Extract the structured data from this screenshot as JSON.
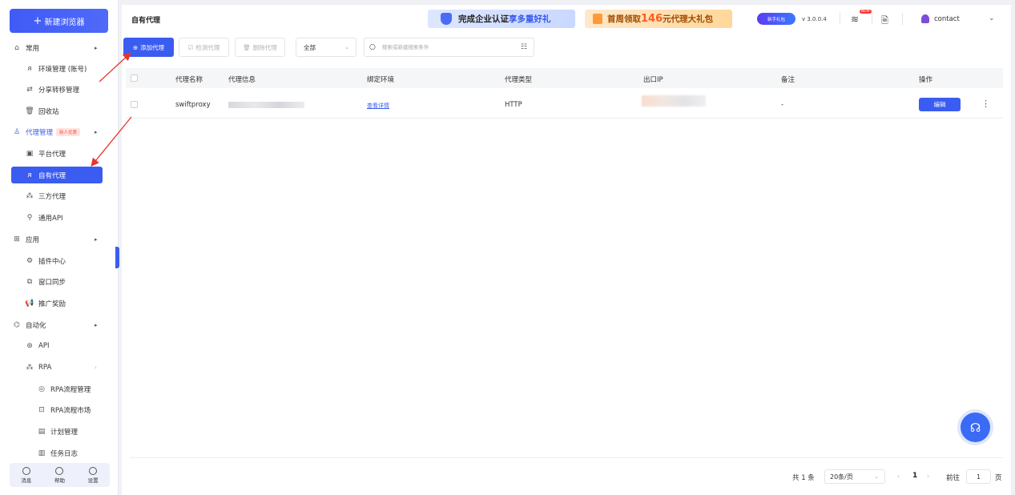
{
  "sidebar": {
    "new_browser": "新建浏览器",
    "items": [
      {
        "label": "常用",
        "level": "group"
      },
      {
        "label": "环境管理 (账号)",
        "level": "sub"
      },
      {
        "label": "分享转移管理",
        "level": "sub"
      },
      {
        "label": "回收站",
        "level": "sub"
      },
      {
        "label": "代理管理",
        "level": "group",
        "badge": "新人优惠"
      },
      {
        "label": "平台代理",
        "level": "sub"
      },
      {
        "label": "自有代理",
        "level": "sub",
        "active": true
      },
      {
        "label": "三方代理",
        "level": "sub"
      },
      {
        "label": "通用API",
        "level": "sub"
      },
      {
        "label": "应用",
        "level": "group"
      },
      {
        "label": "插件中心",
        "level": "sub"
      },
      {
        "label": "窗口同步",
        "level": "sub"
      },
      {
        "label": "推广奖励",
        "level": "sub"
      },
      {
        "label": "自动化",
        "level": "group"
      },
      {
        "label": "API",
        "level": "sub"
      },
      {
        "label": "RPA",
        "level": "sub"
      },
      {
        "label": "RPA流程管理",
        "level": "sub2"
      },
      {
        "label": "RPA流程市场",
        "level": "sub2"
      },
      {
        "label": "计划管理",
        "level": "sub2"
      },
      {
        "label": "任务日志",
        "level": "sub2"
      }
    ],
    "bottom": {
      "messages": "消息",
      "help": "帮助",
      "settings": "设置"
    }
  },
  "header": {
    "title": "自有代理",
    "promo1": {
      "text": "完成企业认证",
      "highlight": "享多重好礼"
    },
    "promo2": {
      "text_a": "首周领取",
      "big": "146",
      "text_b": "元代理大礼包"
    },
    "novice": "新手礼包",
    "version": "v 3.0.0.4",
    "new_tag": "NEW",
    "user": "contact"
  },
  "toolbar": {
    "add": "添加代理",
    "check": "检测代理",
    "delete": "删除代理",
    "filter_value": "全部",
    "search_placeholder": "搜索或新建搜索条件"
  },
  "table": {
    "columns": [
      "代理名称",
      "代理信息",
      "绑定环境",
      "代理类型",
      "出口IP",
      "备注",
      "操作"
    ],
    "rows": [
      {
        "name": "swiftproxy",
        "env": "查看详情",
        "type": "HTTP",
        "remark": "-",
        "action": "编辑"
      }
    ]
  },
  "pager": {
    "total": "共 1 条",
    "page_size": "20条/页",
    "current": "1",
    "goto_label": "前往",
    "goto_value": "1",
    "page_unit": "页"
  },
  "colors": {
    "accent": "#3b5cf0",
    "annotation": "#e8352b"
  }
}
